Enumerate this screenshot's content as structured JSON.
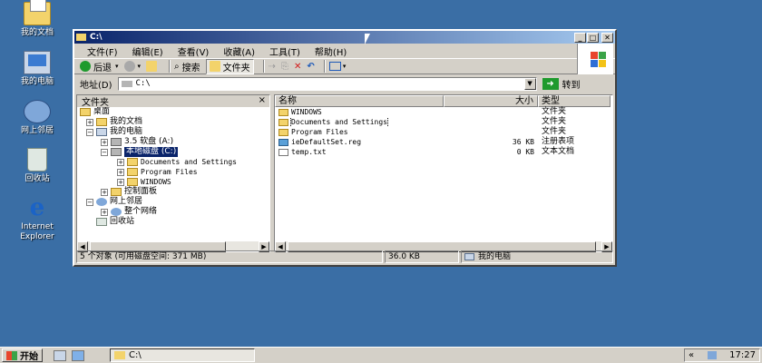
{
  "desktop": {
    "icons": [
      {
        "label": "我的文档",
        "icon": "my-documents-icon"
      },
      {
        "label": "我的电脑",
        "icon": "my-computer-icon"
      },
      {
        "label": "网上邻居",
        "icon": "network-places-icon"
      },
      {
        "label": "回收站",
        "icon": "recycle-bin-icon"
      },
      {
        "label": "Internet\nExplorer",
        "icon": "internet-explorer-icon"
      }
    ]
  },
  "window": {
    "title": "C:\\",
    "menu": [
      "文件(F)",
      "编辑(E)",
      "查看(V)",
      "收藏(A)",
      "工具(T)",
      "帮助(H)"
    ],
    "toolbar": {
      "back": "后退",
      "search": "搜索",
      "folders": "文件夹"
    },
    "address": {
      "label": "地址(D)",
      "value": "C:\\",
      "go": "转到"
    },
    "folders_pane": {
      "title": "文件夹",
      "close": "×",
      "tree": [
        {
          "label": "桌面",
          "level": 0,
          "expander": "",
          "icon": "fold"
        },
        {
          "label": "我的文档",
          "level": 1,
          "expander": "+",
          "icon": "fold"
        },
        {
          "label": "我的电脑",
          "level": 1,
          "expander": "−",
          "icon": "pc"
        },
        {
          "label": "3.5 软盘 (A:)",
          "level": 2,
          "expander": "+",
          "icon": "drv"
        },
        {
          "label": "本地磁盘 (C:)",
          "level": 2,
          "expander": "−",
          "icon": "drv",
          "selected": true
        },
        {
          "label": "Documents and Settings",
          "level": 3,
          "expander": "+",
          "icon": "fold"
        },
        {
          "label": "Program Files",
          "level": 3,
          "expander": "+",
          "icon": "fold"
        },
        {
          "label": "WINDOWS",
          "level": 3,
          "expander": "+",
          "icon": "fold"
        },
        {
          "label": "控制面板",
          "level": 2,
          "expander": "+",
          "icon": "fold"
        },
        {
          "label": "网上邻居",
          "level": 1,
          "expander": "−",
          "icon": "net"
        },
        {
          "label": "整个网络",
          "level": 2,
          "expander": "+",
          "icon": "net"
        },
        {
          "label": "回收站",
          "level": 1,
          "expander": "",
          "icon": "fold"
        }
      ]
    },
    "columns": {
      "name": "名称",
      "size": "大小",
      "type": "类型"
    },
    "files": [
      {
        "name": "WINDOWS",
        "size": "",
        "type": "文件夹",
        "icon": "fold"
      },
      {
        "name": "Documents and Settings",
        "size": "",
        "type": "文件夹",
        "icon": "fold",
        "focused": true
      },
      {
        "name": "Program Files",
        "size": "",
        "type": "文件夹",
        "icon": "fold"
      },
      {
        "name": "ieDefaultSet.reg",
        "size": "36 KB",
        "type": "注册表项",
        "icon": "reg"
      },
      {
        "name": "temp.txt",
        "size": "0 KB",
        "type": "文本文档",
        "icon": "txt"
      }
    ],
    "status": {
      "count": "5 个对象 (可用磁盘空间: 371 MB)",
      "size": "36.0 KB",
      "location": "我的电脑"
    }
  },
  "taskbar": {
    "start": "开始",
    "task": "C:\\",
    "tray_toggle": "«",
    "clock": "17:27"
  },
  "colors": {
    "desktop": "#3a6ea5",
    "titlebar": "#0a246a",
    "selection": "#0a246a",
    "chrome": "#d4d0c8"
  }
}
